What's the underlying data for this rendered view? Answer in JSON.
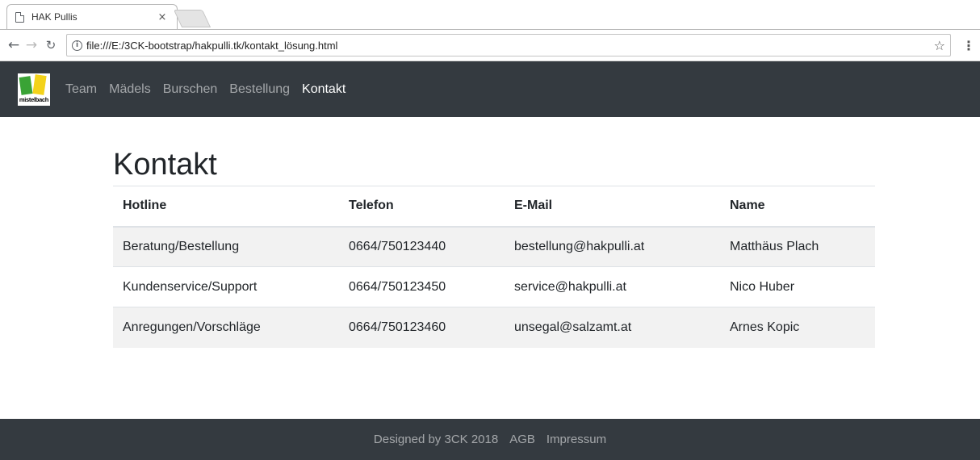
{
  "browser": {
    "tab_title": "HAK Pullis",
    "tab_close": "×",
    "url": "file:///E:/3CK-bootstrap/hakpulli.tk/kontakt_lösung.html"
  },
  "navbar": {
    "logo_text": "mistelbach",
    "links": [
      {
        "label": "Team",
        "active": false
      },
      {
        "label": "Mädels",
        "active": false
      },
      {
        "label": "Burschen",
        "active": false
      },
      {
        "label": "Bestellung",
        "active": false
      },
      {
        "label": "Kontakt",
        "active": true
      }
    ]
  },
  "main": {
    "title": "Kontakt",
    "table": {
      "headers": [
        "Hotline",
        "Telefon",
        "E-Mail",
        "Name"
      ],
      "rows": [
        [
          "Beratung/Bestellung",
          "0664/750123440",
          "bestellung@hakpulli.at",
          "Matthäus Plach"
        ],
        [
          "Kundenservice/Support",
          "0664/750123450",
          "service@hakpulli.at",
          "Nico Huber"
        ],
        [
          "Anregungen/Vorschläge",
          "0664/750123460",
          "unsegal@salzamt.at",
          "Arnes Kopic"
        ]
      ]
    }
  },
  "footer": {
    "credit": "Designed by 3CK 2018",
    "agb": "AGB",
    "impressum": "Impressum"
  },
  "colors": {
    "navbar_bg": "#343a40",
    "footer_bg": "#343a40",
    "logo_green": "#3aa335",
    "logo_yellow": "#f3d21a"
  },
  "icons": {
    "tab": "page-icon",
    "back": "arrow-left-icon",
    "forward": "arrow-right-icon",
    "reload": "reload-icon",
    "info": "info-icon",
    "bookmark": "star-icon",
    "menu": "kebab-menu-icon"
  }
}
